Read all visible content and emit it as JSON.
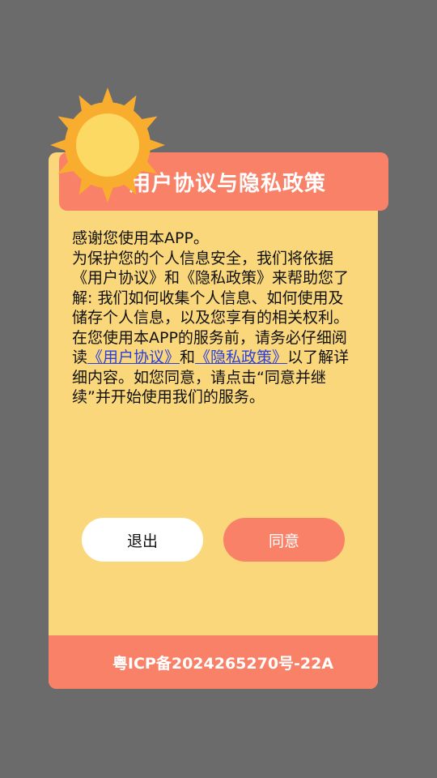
{
  "dialog": {
    "title": "用户协议与隐私政策",
    "body": {
      "greeting": "感谢您使用本APP。",
      "p1": "为保护您的个人信息安全，我们将依据《用户协议》和《隐私政策》来帮助您了解: 我们如何收集个人信息、如何使用及储存个人信息，以及您享有的相关权利。",
      "p2_before": "在您使用本APP的服务前，请务必仔细阅读",
      "link_user_agreement": "《用户协议》",
      "p2_and": "和",
      "link_privacy_policy": "《隐私政策》",
      "p2_after": "以了解详细内容。如您同意，请点击“同意并继续”并开始使用我们的服务。"
    },
    "buttons": {
      "exit_label": "退出",
      "agree_label": "同意"
    },
    "footer": {
      "icp": "粤ICP备2024265270号-22A"
    }
  },
  "colors": {
    "backdrop": "#6b6b6b",
    "dialog_bg": "#fad77b",
    "accent": "#f98168",
    "link": "#2a3fe0",
    "sun_outer": "#f9ad2f",
    "sun_inner": "#fcd963"
  },
  "icons": {
    "decoration": "sun-icon"
  }
}
